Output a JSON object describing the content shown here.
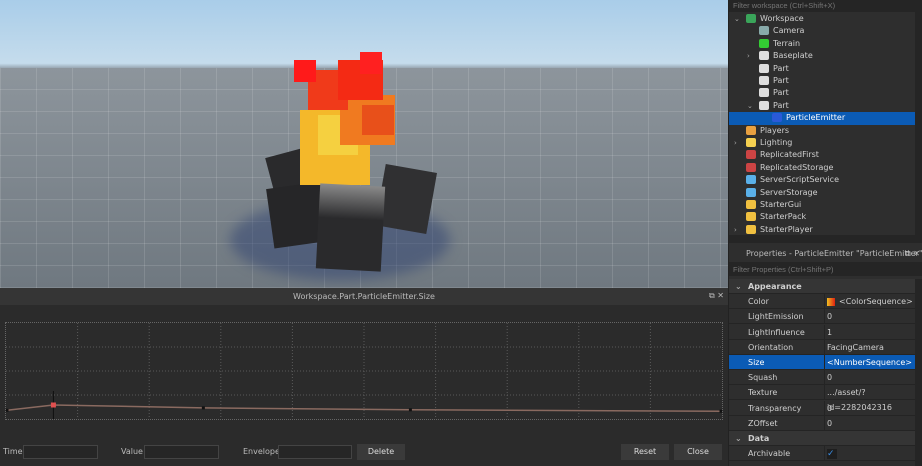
{
  "explorer": {
    "filter_placeholder": "Filter workspace (Ctrl+Shift+X)",
    "items": [
      {
        "label": "Workspace",
        "icon": "globe-icon",
        "depth": 0,
        "expand": "open"
      },
      {
        "label": "Camera",
        "icon": "camera-icon",
        "depth": 1,
        "expand": ""
      },
      {
        "label": "Terrain",
        "icon": "terrain-icon",
        "depth": 1,
        "expand": ""
      },
      {
        "label": "Baseplate",
        "icon": "part-icon",
        "depth": 1,
        "expand": "closed"
      },
      {
        "label": "Part",
        "icon": "part-icon",
        "depth": 1,
        "expand": ""
      },
      {
        "label": "Part",
        "icon": "part-icon",
        "depth": 1,
        "expand": ""
      },
      {
        "label": "Part",
        "icon": "part-icon",
        "depth": 1,
        "expand": ""
      },
      {
        "label": "Part",
        "icon": "part-icon",
        "depth": 1,
        "expand": "open"
      },
      {
        "label": "ParticleEmitter",
        "icon": "particle-emitter-icon",
        "depth": 2,
        "expand": "",
        "selected": true
      },
      {
        "label": "Players",
        "icon": "players-icon",
        "depth": 0,
        "expand": ""
      },
      {
        "label": "Lighting",
        "icon": "lightbulb-icon",
        "depth": 0,
        "expand": "closed"
      },
      {
        "label": "ReplicatedFirst",
        "icon": "replicated-first-icon",
        "depth": 0,
        "expand": ""
      },
      {
        "label": "ReplicatedStorage",
        "icon": "replicated-storage-icon",
        "depth": 0,
        "expand": ""
      },
      {
        "label": "ServerScriptService",
        "icon": "server-script-service-icon",
        "depth": 0,
        "expand": ""
      },
      {
        "label": "ServerStorage",
        "icon": "server-storage-icon",
        "depth": 0,
        "expand": ""
      },
      {
        "label": "StarterGui",
        "icon": "starter-gui-icon",
        "depth": 0,
        "expand": ""
      },
      {
        "label": "StarterPack",
        "icon": "starter-pack-icon",
        "depth": 0,
        "expand": ""
      },
      {
        "label": "StarterPlayer",
        "icon": "starter-player-icon",
        "depth": 0,
        "expand": "closed"
      }
    ]
  },
  "properties": {
    "title": "Properties - ParticleEmitter \"ParticleEmitter\"",
    "filter_placeholder": "Filter Properties (Ctrl+Shift+P)",
    "rows": [
      {
        "cat": "Appearance"
      },
      {
        "k": "Color",
        "v": "<ColorSequence>",
        "swatch": true
      },
      {
        "k": "LightEmission",
        "v": "0"
      },
      {
        "k": "LightInfluence",
        "v": "1"
      },
      {
        "k": "Orientation",
        "v": "FacingCamera"
      },
      {
        "k": "Size",
        "v": "<NumberSequence>",
        "selected": true
      },
      {
        "k": "Squash",
        "v": "0"
      },
      {
        "k": "Texture",
        "v": ".../asset/?id=2282042316"
      },
      {
        "k": "Transparency",
        "v": "0"
      },
      {
        "k": "ZOffset",
        "v": "0"
      },
      {
        "cat": "Data"
      },
      {
        "k": "Archivable",
        "v": "",
        "check": true
      }
    ]
  },
  "editor": {
    "title": "Workspace.Part.ParticleEmitter.Size",
    "time_label": "Time",
    "value_label": "Value",
    "envelope_label": "Envelope",
    "delete_label": "Delete",
    "reset_label": "Reset",
    "close_label": "Close",
    "time_value": "",
    "value_value": "",
    "envelope_value": "",
    "keypoints": [
      {
        "time": 0,
        "value": 0.14
      },
      {
        "time": 0.065,
        "value": 0.25,
        "selected": true
      },
      {
        "time": 0.275,
        "value": 0.19
      },
      {
        "time": 0.565,
        "value": 0.15
      },
      {
        "time": 1,
        "value": 0.12
      }
    ]
  },
  "colors": {
    "selection": "#0b5bb5",
    "keypoint_selected": "#e05050"
  }
}
